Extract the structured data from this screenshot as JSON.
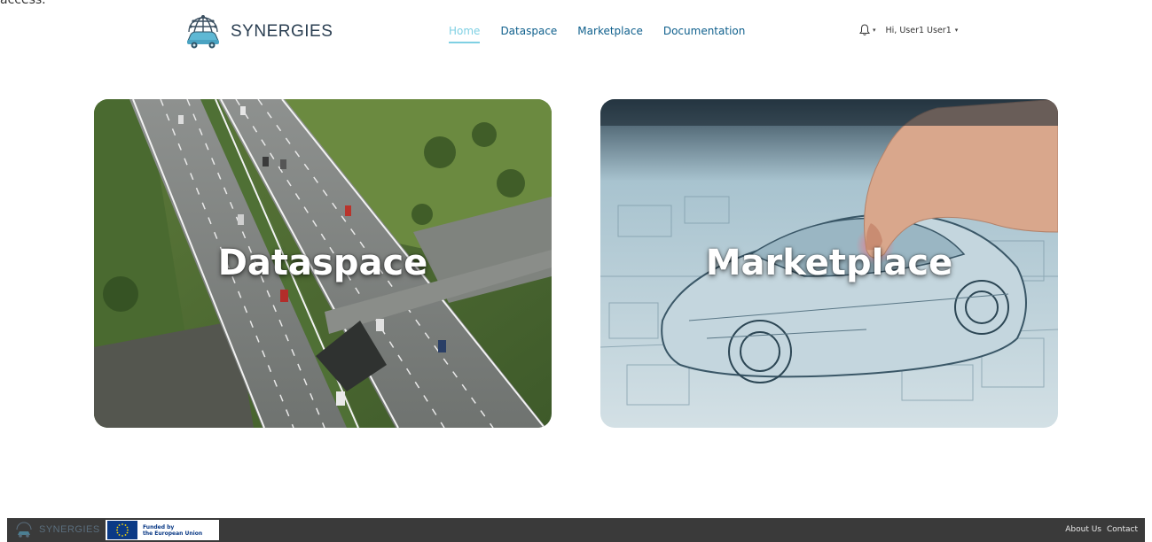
{
  "header": {
    "brand": "SYNERGIES",
    "nav": [
      {
        "label": "Home",
        "active": true
      },
      {
        "label": "Dataspace",
        "active": false
      },
      {
        "label": "Marketplace",
        "active": false
      },
      {
        "label": "Documentation",
        "active": false
      }
    ],
    "notification_icon": "bell-icon",
    "greeting": "Hi, User1 User1"
  },
  "cards": [
    {
      "label": "Dataspace",
      "image": "highway-aerial-photo"
    },
    {
      "label": "Marketplace",
      "image": "car-blueprint-photo"
    }
  ],
  "footer": {
    "logo_text": "SYNERGIES",
    "funding_line1": "Funded by",
    "funding_line2": "the European Union",
    "links": [
      "About Us",
      "Contact"
    ]
  },
  "colors": {
    "nav_link": "#0e5f8c",
    "nav_active": "#7fd0e3",
    "footer_bg": "#3a3a3a",
    "brand_text": "#2b3f52"
  }
}
